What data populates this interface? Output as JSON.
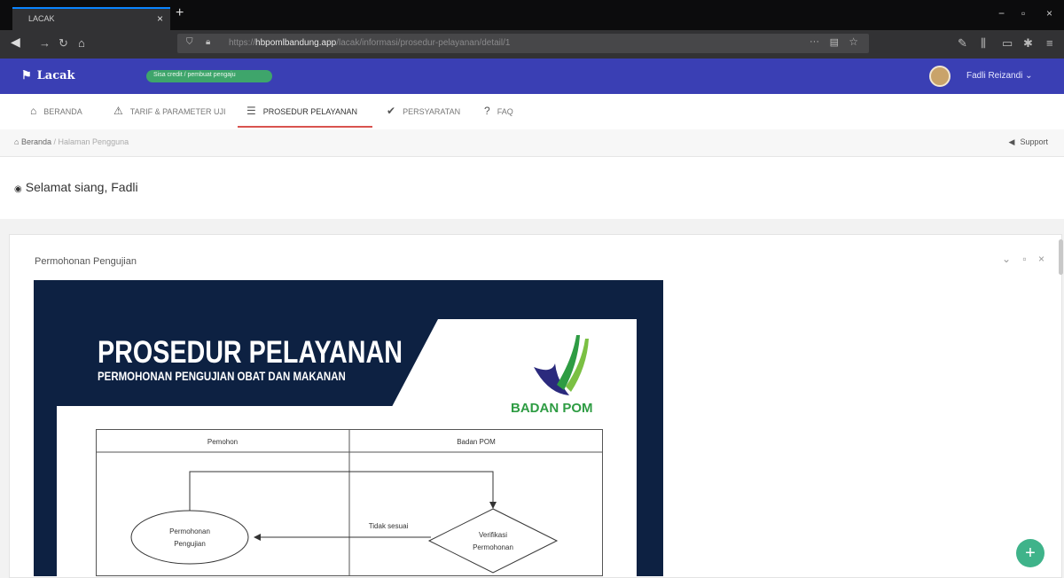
{
  "browser": {
    "tab_title": "LACAK",
    "tab_close": "×",
    "new_tab": "+",
    "url_prefix": "https://",
    "url_host": "hbpomlbandung.app",
    "url_path": "/lacak/informasi/prosedur-pelayanan/detail/1",
    "window_controls": [
      "−",
      "▫",
      "×"
    ]
  },
  "app": {
    "logo": "Lacak",
    "status_badge": "Sisa credit / pembuat pengaju",
    "user_name": "Fadli Reizandi ⌄",
    "colors": {
      "header": "#3a3fb4",
      "badge": "#3ea56b",
      "active_underline": "#d9534f"
    }
  },
  "nav": {
    "items": [
      {
        "label": "BERANDA",
        "icon": "⌂"
      },
      {
        "label": "TARIF & PARAMETER UJI",
        "icon": "⚠"
      },
      {
        "label": "PROSEDUR PELAYANAN",
        "icon": "☰"
      },
      {
        "label": "PERSYARATAN",
        "icon": "✔"
      },
      {
        "label": "FAQ",
        "icon": "?"
      }
    ]
  },
  "breadcrumb": {
    "home": "Beranda",
    "separator": "/",
    "current": "Halaman Pengguna"
  },
  "support": "Support",
  "greeting": "Selamat siang, Fadli",
  "panel": {
    "title": "Permohonan Pengujian",
    "tools": "⌄ ▫ ×"
  },
  "poster": {
    "title": "PROSEDUR PELAYANAN",
    "subtitle": "PERMOHONAN PENGUJIAN OBAT DAN MAKANAN",
    "brand": "BADAN POM",
    "columns": [
      "Pemohon",
      "Badan POM"
    ],
    "node_request": [
      "Permohonan",
      "Pengujian"
    ],
    "node_verify": [
      "Verifikasi",
      "Permohonan"
    ],
    "edge_label": "Tidak sesuai"
  },
  "fab": "+"
}
